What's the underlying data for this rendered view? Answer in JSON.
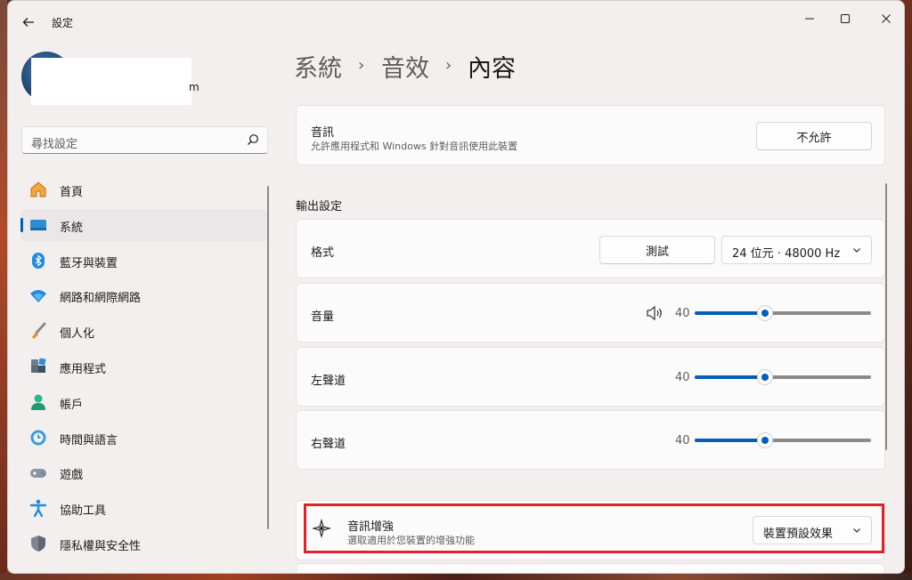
{
  "window": {
    "title": "設定",
    "back_icon": "back-arrow-icon",
    "controls": [
      "minimize-icon",
      "maximize-icon",
      "close-icon"
    ]
  },
  "user": {
    "name_tail": "m"
  },
  "search": {
    "placeholder": "尋找設定"
  },
  "sidebar": {
    "items": [
      {
        "label": "首頁",
        "icon": "home-icon"
      },
      {
        "label": "系統",
        "icon": "system-icon",
        "active": true
      },
      {
        "label": "藍牙與裝置",
        "icon": "bluetooth-icon"
      },
      {
        "label": "網路和網際網路",
        "icon": "wifi-icon"
      },
      {
        "label": "個人化",
        "icon": "brush-icon"
      },
      {
        "label": "應用程式",
        "icon": "apps-icon"
      },
      {
        "label": "帳戶",
        "icon": "account-icon"
      },
      {
        "label": "時間與語言",
        "icon": "time-language-icon"
      },
      {
        "label": "遊戲",
        "icon": "gamepad-icon"
      },
      {
        "label": "協助工具",
        "icon": "accessibility-icon"
      },
      {
        "label": "隱私權與安全性",
        "icon": "shield-icon"
      }
    ]
  },
  "breadcrumb": {
    "level1": "系統",
    "level2": "音效",
    "current": "內容",
    "separator": "›"
  },
  "audio_card": {
    "title": "音訊",
    "subtitle": "允許應用程式和 Windows 針對音訊使用此裝置",
    "button": "不允許"
  },
  "output_settings": {
    "section_title": "輸出設定",
    "format": {
      "label": "格式",
      "test_button": "測試",
      "value": "24 位元 · 48000 Hz"
    },
    "volume": {
      "label": "音量",
      "value": "40",
      "level": 40,
      "icon": "speaker-icon"
    },
    "left_channel": {
      "label": "左聲道",
      "value": "40",
      "level": 40
    },
    "right_channel": {
      "label": "右聲道",
      "value": "40",
      "level": 40
    }
  },
  "enhancement": {
    "title": "音訊增強",
    "subtitle": "選取適用於您裝置的增強功能",
    "value": "裝置預設效果",
    "icon": "sparkle-icon"
  },
  "colors": {
    "accent": "#005fb8",
    "highlight_box": "#e0202a"
  }
}
